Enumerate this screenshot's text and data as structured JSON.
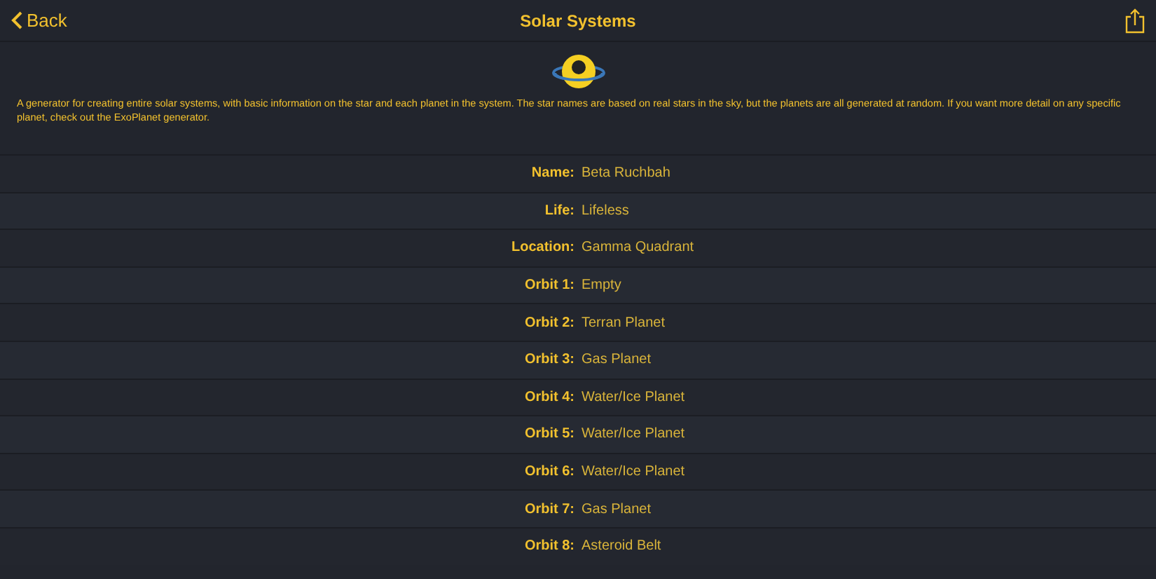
{
  "nav": {
    "back": "Back",
    "title": "Solar Systems"
  },
  "description": "A generator for creating entire solar systems, with basic information on the star and each planet in the system. The star names are based on real stars in the sky, but the planets are all generated at random. If you want more detail on any specific planet, check out the ExoPlanet generator.",
  "rows": [
    {
      "label": "Name:",
      "value": "Beta Ruchbah"
    },
    {
      "label": "Life:",
      "value": "Lifeless"
    },
    {
      "label": "Location:",
      "value": "Gamma Quadrant"
    },
    {
      "label": "Orbit 1:",
      "value": "Empty"
    },
    {
      "label": "Orbit 2:",
      "value": "Terran Planet"
    },
    {
      "label": "Orbit 3:",
      "value": "Gas Planet"
    },
    {
      "label": "Orbit 4:",
      "value": "Water/Ice Planet"
    },
    {
      "label": "Orbit 5:",
      "value": "Water/Ice Planet"
    },
    {
      "label": "Orbit 6:",
      "value": "Water/Ice Planet"
    },
    {
      "label": "Orbit 7:",
      "value": "Gas Planet"
    },
    {
      "label": "Orbit 8:",
      "value": "Asteroid Belt"
    }
  ]
}
